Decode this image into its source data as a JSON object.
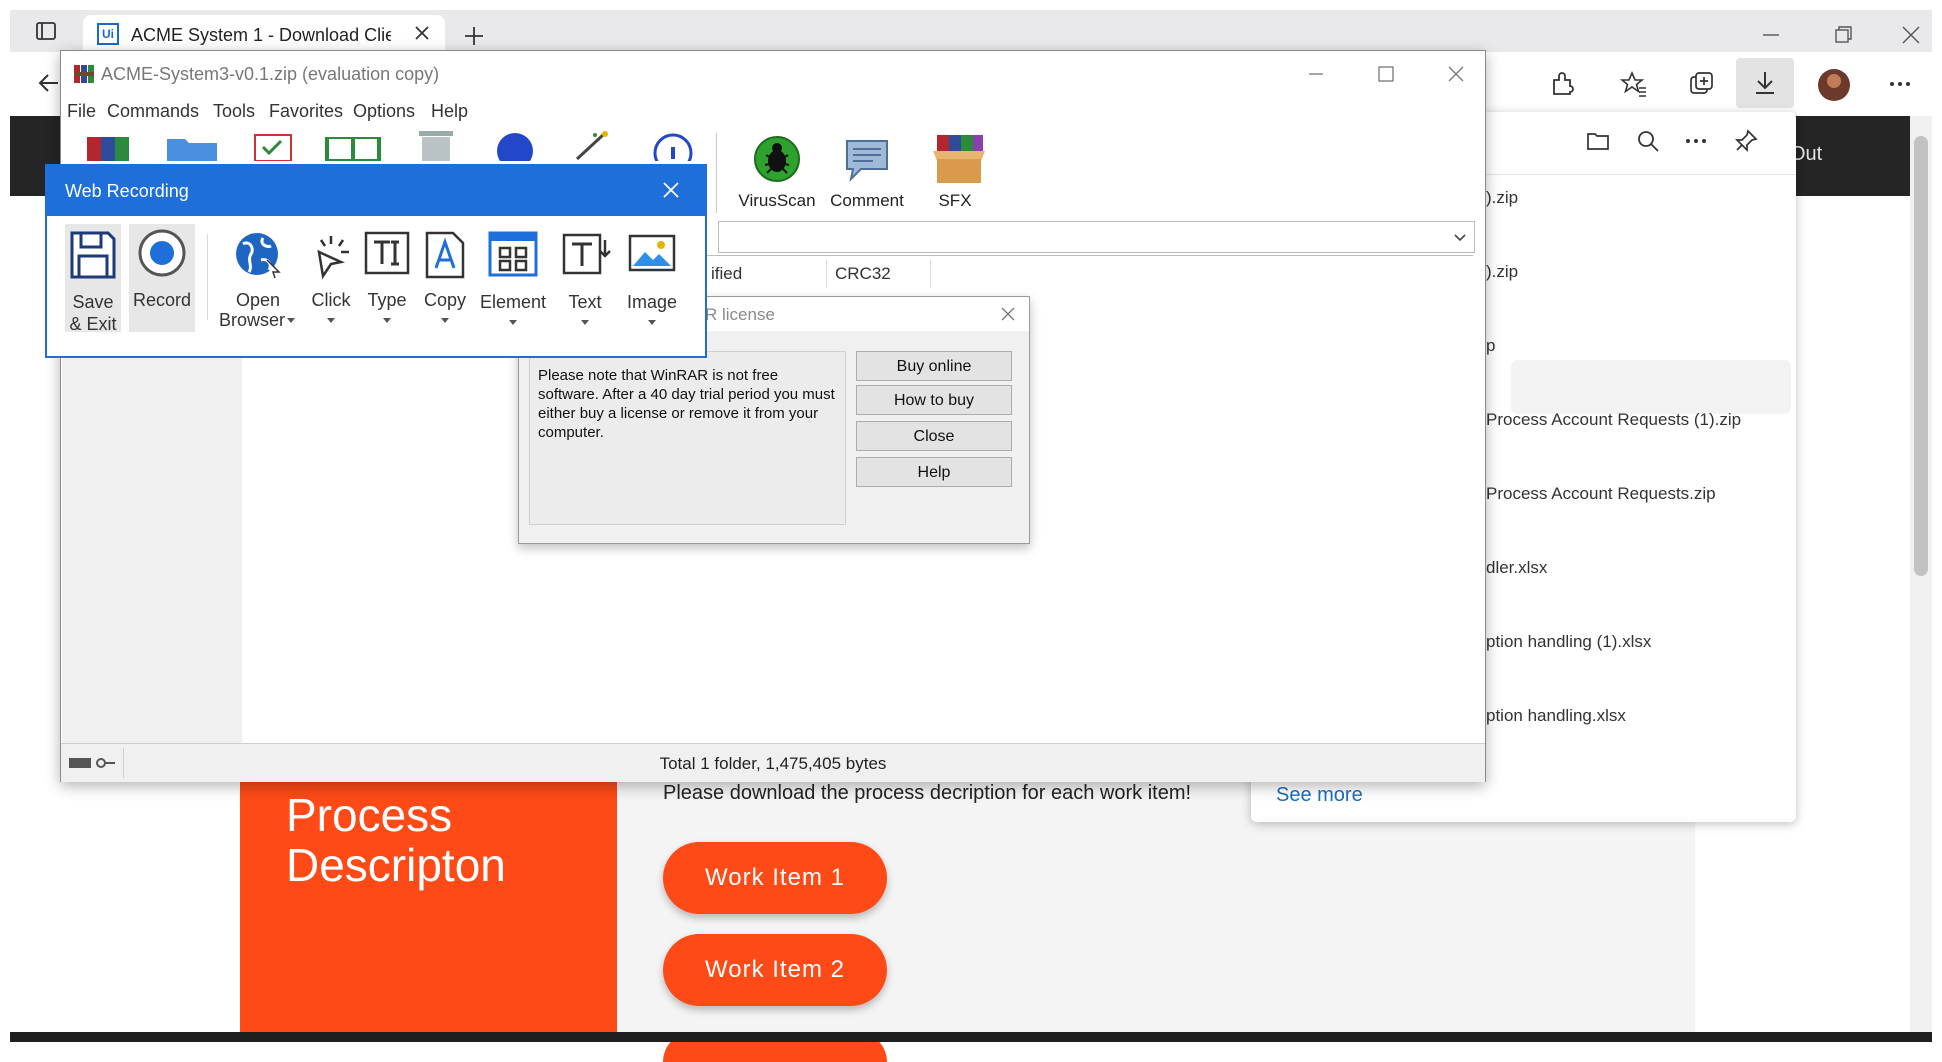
{
  "browser": {
    "tab_title": "ACME System 1 - Download Clie",
    "tab_favicon": "Ui",
    "accent": "#1b6ac9"
  },
  "page": {
    "logout_label": "Out",
    "section_title": "Process Descripton",
    "instruction": "Please download the process decription for each work item!",
    "work_items": [
      "Work Item 1",
      "Work Item 2"
    ],
    "accent": "#fd4a17"
  },
  "downloads": {
    "items": [
      ").zip",
      ").zip",
      "p",
      "Process Account Requests (1).zip",
      "Process Account Requests.zip",
      "dler.xlsx",
      "ption handling (1).xlsx",
      "ption handling.xlsx"
    ],
    "see_more": "See more"
  },
  "winrar": {
    "title": "ACME-System3-v0.1.zip (evaluation copy)",
    "menu": [
      "File",
      "Commands",
      "Tools",
      "Favorites",
      "Options",
      "Help"
    ],
    "tools_visible": [
      "VirusScan",
      "Comment",
      "SFX"
    ],
    "columns": [
      "ified",
      "CRC32"
    ],
    "status": "Total 1 folder, 1,475,405 bytes"
  },
  "license_dialog": {
    "title": "R license",
    "message": "Please note that WinRAR is not free software. After a 40 day trial period you must either buy a license or remove it from your computer.",
    "buttons": [
      "Buy online",
      "How to buy",
      "Close",
      "Help"
    ]
  },
  "web_recording": {
    "title": "Web Recording",
    "accent": "#1e6fd9",
    "save_exit_line1": "Save",
    "save_exit_line2": "& Exit",
    "record": "Record",
    "open_browser_line1": "Open",
    "open_browser_line2": "Browser",
    "click": "Click",
    "type": "Type",
    "copy": "Copy",
    "element": "Element",
    "text": "Text",
    "image": "Image"
  }
}
